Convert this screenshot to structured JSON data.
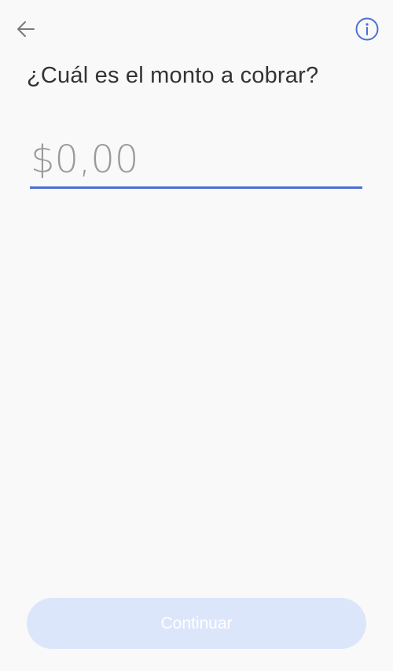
{
  "header": {
    "back_icon": "arrow-left-icon",
    "info_icon": "info-circle-icon"
  },
  "main": {
    "title": "¿Cuál es el monto a cobrar?",
    "amount_placeholder": "$0,00",
    "amount_value": ""
  },
  "footer": {
    "continue_label": "Continuar"
  },
  "colors": {
    "background": "#f9f9f9",
    "accent": "#4a6fd8",
    "button_disabled": "#dce6fb",
    "title_text": "#333333",
    "placeholder_text": "#9a9a9a"
  }
}
